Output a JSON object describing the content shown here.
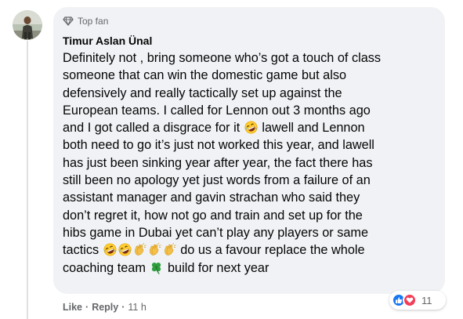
{
  "comment": {
    "badge": "Top fan",
    "author": "Timur Aslan Ünal",
    "lines": [
      "Definitely not , bring someone who’s got a touch of class",
      "someone that can win the domestic game but also",
      "defensively and really tactically set up against the",
      "European teams. I called for Lennon out 3 months ago",
      "and I got called a disgrace for it",
      "lawell and Lennon",
      "both need to go it’s just not worked this year, and lawell",
      "has just been sinking year after year, the fact there has",
      "still been no apology yet just words from a failure of an",
      "assistant manager and gavin strachan who said they",
      "don’t regret it, how not go and train and set up for the",
      "hibs game in Dubai yet can’t play any players or same",
      "tactics",
      "do us a favour replace the whole",
      "coaching team",
      "build for next year"
    ],
    "emojis": {
      "laughing": "rolling-on-floor-laughing-emoji",
      "clap": "clapping-hands-emoji",
      "clover": "four-leaf-clover-emoji"
    }
  },
  "actions": {
    "like_label": "Like",
    "reply_label": "Reply",
    "separator": "·",
    "timestamp": "11 h"
  },
  "reactions": {
    "count": "11",
    "types": [
      "like",
      "love"
    ]
  },
  "colors": {
    "bubble": "#f0f2f5",
    "like": "#1877f2",
    "love": "#f33e58",
    "secondary_text": "#65676b"
  }
}
